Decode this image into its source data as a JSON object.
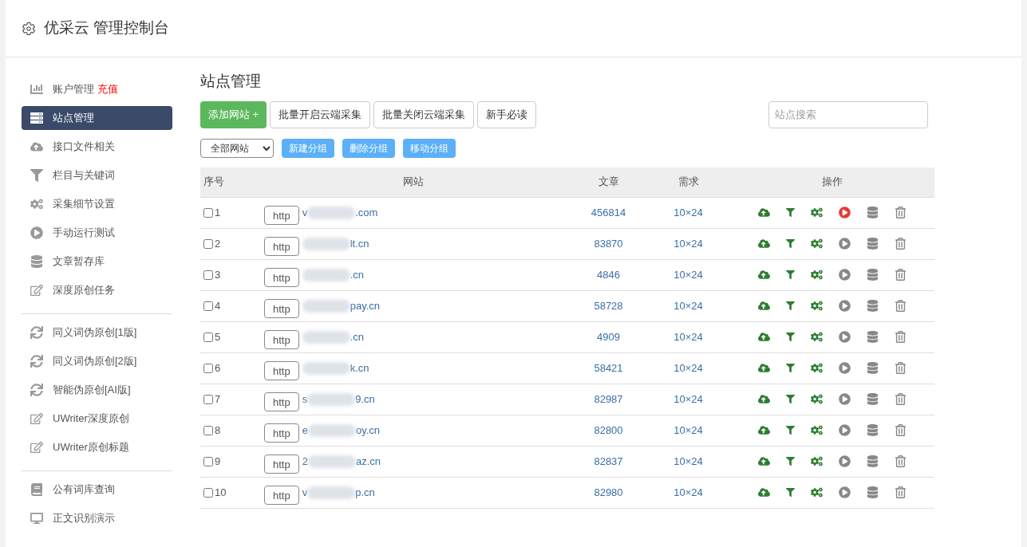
{
  "header": {
    "title": "优采云 管理控制台"
  },
  "sidebar": {
    "groups": [
      [
        {
          "label": "账户管理",
          "badge": "充值",
          "kind": "chart",
          "selected": false
        },
        {
          "label": "站点管理",
          "kind": "server",
          "selected": true
        },
        {
          "label": "接口文件相关",
          "kind": "cloud",
          "selected": false
        },
        {
          "label": "栏目与关键词",
          "kind": "filter",
          "selected": false
        },
        {
          "label": "采集细节设置",
          "kind": "cogs",
          "selected": false
        },
        {
          "label": "手动运行测试",
          "kind": "play",
          "selected": false
        },
        {
          "label": "文章暂存库",
          "kind": "database",
          "selected": false
        },
        {
          "label": "深度原创任务",
          "kind": "edit",
          "selected": false
        }
      ],
      [
        {
          "label": "同义词伪原创[1版]",
          "kind": "sync",
          "selected": false
        },
        {
          "label": "同义词伪原创[2版]",
          "kind": "sync",
          "selected": false
        },
        {
          "label": "智能伪原创[AI版]",
          "kind": "sync",
          "selected": false
        },
        {
          "label": "UWriter深度原创",
          "kind": "edit",
          "selected": false
        },
        {
          "label": "UWriter原创标题",
          "kind": "edit",
          "selected": false
        }
      ],
      [
        {
          "label": "公有词库查询",
          "kind": "book",
          "selected": false
        },
        {
          "label": "正文识别演示",
          "kind": "desktop",
          "selected": false
        }
      ]
    ]
  },
  "main": {
    "title": "站点管理",
    "add_button": "添加网站 +",
    "buttons": [
      "批量开启云端采集",
      "批量关闭云端采集",
      "新手必读"
    ],
    "search": {
      "placeholder": "站点搜索"
    },
    "group_select": "全部网站",
    "group_buttons": [
      "新建分组",
      "删除分组",
      "移动分组"
    ],
    "table": {
      "columns": [
        "序号",
        "网站",
        "文章",
        "需求",
        "操作"
      ],
      "rows": [
        {
          "checked": false,
          "no": "1",
          "scheme": "http",
          "site_start": "v",
          "site_end": ".com",
          "articles": "456814",
          "demand": "10×24",
          "running": true
        },
        {
          "checked": false,
          "no": "2",
          "scheme": "http",
          "site_end": "lt.cn",
          "articles": "83870",
          "demand": "10×24",
          "running": false
        },
        {
          "checked": false,
          "no": "3",
          "scheme": "http",
          "site_end": ".cn",
          "articles": "4846",
          "demand": "10×24",
          "running": false
        },
        {
          "checked": false,
          "no": "4",
          "scheme": "http",
          "site_end": "pay.cn",
          "articles": "58728",
          "demand": "10×24",
          "running": false
        },
        {
          "checked": false,
          "no": "5",
          "scheme": "http",
          "site_end": ".cn",
          "articles": "4909",
          "demand": "10×24",
          "running": false
        },
        {
          "checked": false,
          "no": "6",
          "scheme": "http",
          "site_end": "k.cn",
          "articles": "58421",
          "demand": "10×24",
          "running": false
        },
        {
          "checked": false,
          "no": "7",
          "scheme": "http",
          "site_start": "s",
          "site_end": "9.cn",
          "articles": "82987",
          "demand": "10×24",
          "running": false
        },
        {
          "checked": false,
          "no": "8",
          "scheme": "http",
          "site_start": "e",
          "site_end": "oy.cn",
          "articles": "82800",
          "demand": "10×24",
          "running": false
        },
        {
          "checked": false,
          "no": "9",
          "scheme": "http",
          "site_start": "2",
          "site_end": "az.cn",
          "articles": "82837",
          "demand": "10×24",
          "running": false
        },
        {
          "checked": false,
          "no": "10",
          "scheme": "http",
          "site_start": "v",
          "site_end": "p.cn",
          "articles": "82980",
          "demand": "10×24",
          "running": false
        }
      ]
    }
  }
}
